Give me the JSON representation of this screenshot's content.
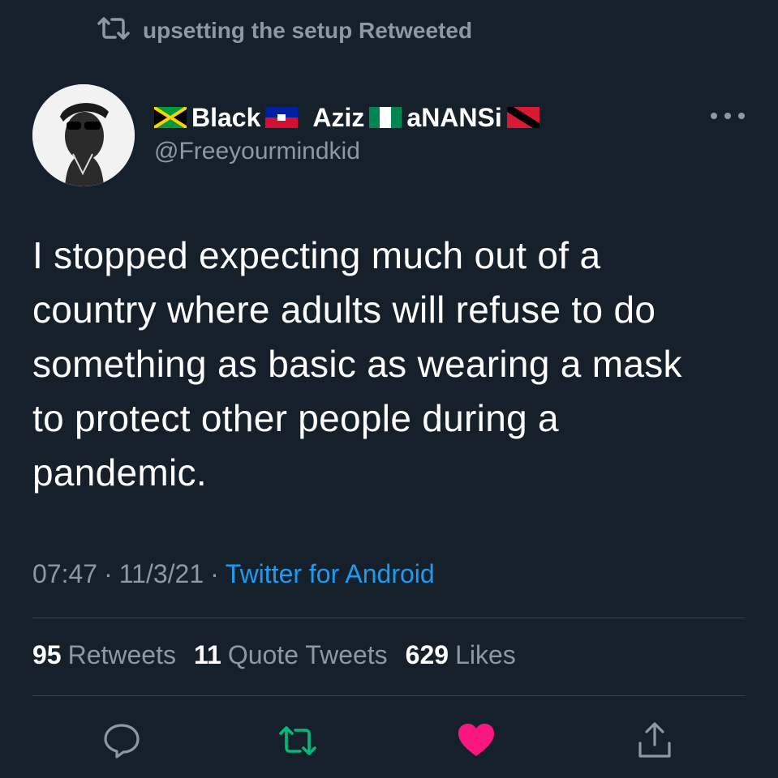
{
  "retweet_banner": {
    "icon": "retweet-icon",
    "text": "upsetting the setup Retweeted"
  },
  "author": {
    "name_parts": [
      "Black",
      "Aziz",
      "aNANSi"
    ],
    "flags": [
      "jamaica-flag",
      "haiti-flag",
      "nigeria-flag",
      "trinidad-flag"
    ],
    "handle": "@Freeyourmindkid"
  },
  "tweet": {
    "text": "I stopped expecting much out of a\ncountry where adults will refuse to do\nsomething as basic as wearing a mask\nto protect other people during a\npandemic.",
    "time": "07:47",
    "separator": "·",
    "date": "11/3/21",
    "source": "Twitter for Android"
  },
  "stats": {
    "retweets_count": "95",
    "retweets_label": "Retweets",
    "quotes_count": "11",
    "quotes_label": "Quote Tweets",
    "likes_count": "629",
    "likes_label": "Likes"
  },
  "actions": [
    "reply-icon",
    "retweet-icon",
    "like-icon",
    "share-icon"
  ],
  "colors": {
    "background": "#15202b",
    "secondary_text": "#8b98a5",
    "link": "#1d9bf0",
    "retweet_active": "#00ba7c",
    "like_active": "#f91880"
  }
}
